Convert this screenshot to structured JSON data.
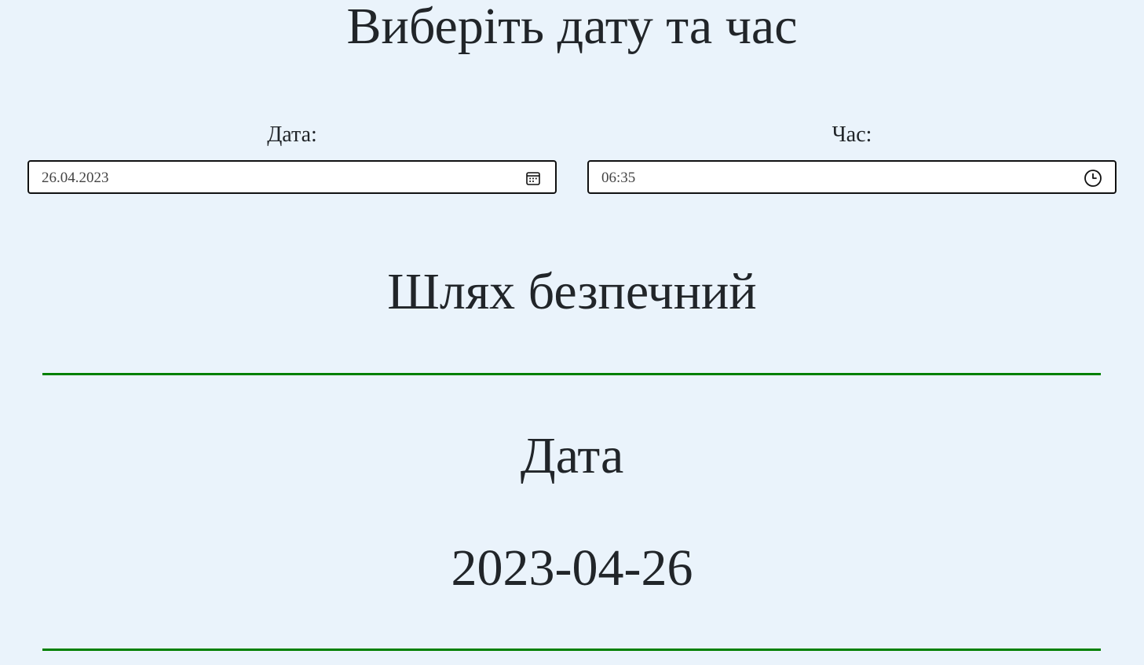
{
  "page": {
    "title": "Виберіть дату та час"
  },
  "date_field": {
    "label": "Дата:",
    "value": "26.04.2023",
    "icon": "calendar-icon"
  },
  "time_field": {
    "label": "Час:",
    "value": "06:35",
    "icon": "clock-icon"
  },
  "status": {
    "text": "Шлях безпечний"
  },
  "result": {
    "heading": "Дата",
    "value": "2023-04-26"
  },
  "colors": {
    "background": "#eaf3fb",
    "divider": "#008000",
    "text": "#212529"
  }
}
